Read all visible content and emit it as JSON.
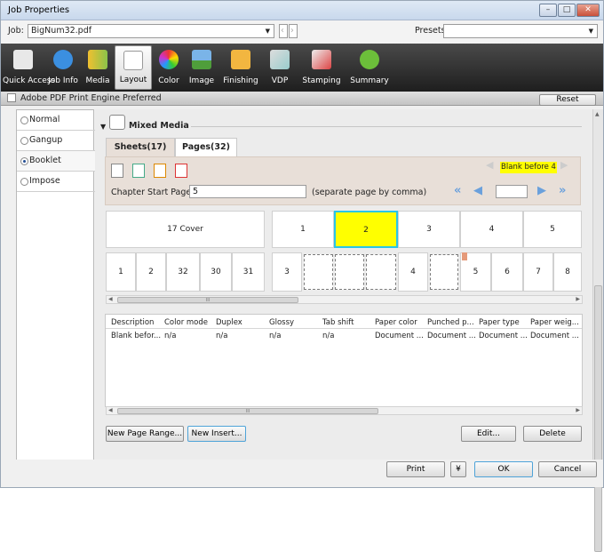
{
  "window": {
    "title": "Job Properties",
    "min": "–",
    "max": "□",
    "close": "✕"
  },
  "job": {
    "label": "Job:",
    "value": "BigNum32.pdf",
    "presets_label": "Presets:",
    "presets_value": ""
  },
  "toolbar": {
    "items": [
      {
        "label": "Quick Access",
        "icon": "quick-access-icon"
      },
      {
        "label": "Job Info",
        "icon": "info-icon"
      },
      {
        "label": "Media",
        "icon": "media-icon"
      },
      {
        "label": "Layout",
        "icon": "layout-icon",
        "active": true
      },
      {
        "label": "Color",
        "icon": "color-icon"
      },
      {
        "label": "Image",
        "icon": "image-icon"
      },
      {
        "label": "Finishing",
        "icon": "finishing-icon"
      },
      {
        "label": "VDP",
        "icon": "vdp-icon"
      },
      {
        "label": "Stamping",
        "icon": "stamping-icon"
      },
      {
        "label": "Summary",
        "icon": "summary-icon"
      }
    ]
  },
  "engine": {
    "label": "Adobe PDF Print Engine Preferred",
    "reset": "Reset"
  },
  "layout_modes": [
    "Normal",
    "Gangup",
    "Booklet",
    "Impose"
  ],
  "section": {
    "title": "Mixed Media"
  },
  "tabs": {
    "sheets": "Sheets(17)",
    "pages": "Pages(32)"
  },
  "chapter": {
    "label": "Chapter Start Page(s):",
    "value": "5",
    "hint": "(separate page by comma)"
  },
  "nav": {
    "badge": "Blank before 4",
    "field": ""
  },
  "sheets": {
    "cover": "17 Cover",
    "pages": [
      "1",
      "2",
      "3",
      "4",
      "5"
    ]
  },
  "pages_row1": [
    "1",
    "2",
    "32",
    "30",
    "31"
  ],
  "pages_row2": [
    "3",
    "",
    "",
    "",
    "4",
    "",
    "5",
    "6",
    "7",
    "8"
  ],
  "scroll_grip": "III",
  "table": {
    "headers": [
      "Description",
      "Color mode",
      "Duplex",
      "Glossy",
      "Tab shift",
      "Paper color",
      "Punched p...",
      "Paper type",
      "Paper weig..."
    ],
    "row": [
      "Blank befor...",
      "n/a",
      "n/a",
      "n/a",
      "n/a",
      "Document ...",
      "Document ...",
      "Document ...",
      "Document ..."
    ]
  },
  "buttons": {
    "new_range": "New Page Range...",
    "new_insert": "New Insert...",
    "edit": "Edit...",
    "delete": "Delete",
    "print": "Print",
    "ok": "OK",
    "cancel": "Cancel"
  },
  "colors": {
    "highlight": "#ffff00",
    "toolbar_bg": "#2a2a2a",
    "accent": "#6aa0dc"
  }
}
